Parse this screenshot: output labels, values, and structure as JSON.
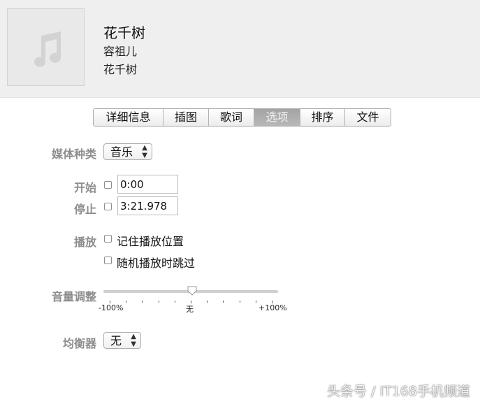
{
  "song": {
    "title": "花千树",
    "artist": "容祖儿",
    "album": "花千树"
  },
  "tabs": [
    {
      "label": "详细信息",
      "active": false
    },
    {
      "label": "插图",
      "active": false
    },
    {
      "label": "歌词",
      "active": false
    },
    {
      "label": "选项",
      "active": true
    },
    {
      "label": "排序",
      "active": false
    },
    {
      "label": "文件",
      "active": false
    }
  ],
  "options": {
    "media_kind_label": "媒体种类",
    "media_kind_value": "音乐",
    "start_label": "开始",
    "start_checked": false,
    "start_value": "0:00",
    "stop_label": "停止",
    "stop_checked": false,
    "stop_value": "3:21.978",
    "playback_label": "播放",
    "remember_position": "记住播放位置",
    "remember_position_checked": false,
    "skip_shuffle": "随机播放时跳过",
    "skip_shuffle_checked": false,
    "volume_label": "音量调整",
    "volume_min": "-100%",
    "volume_mid": "无",
    "volume_max": "+100%",
    "volume_percent": 0,
    "equalizer_label": "均衡器",
    "equalizer_value": "无"
  },
  "watermark": "头条号 / IT168手机频道",
  "icons": {
    "artwork": "music-note-icon",
    "select_arrow": "chevron-updown-icon"
  }
}
